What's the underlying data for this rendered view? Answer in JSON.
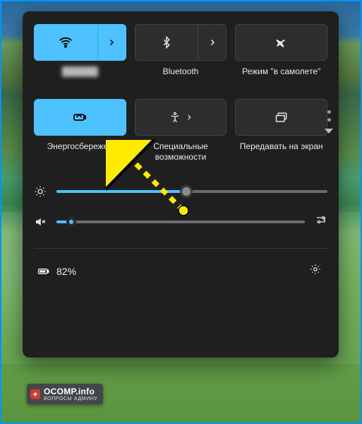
{
  "colors": {
    "accent": "#4dc2ff",
    "panel": "#1f1f1f",
    "tile": "#2d2d2d"
  },
  "tiles": {
    "wifi": {
      "label": "██████",
      "active": true
    },
    "bluetooth": {
      "label": "Bluetooth",
      "active": false
    },
    "airplane": {
      "label": "Режим \"в самолете\"",
      "active": false
    },
    "battery_saver": {
      "label": "Энергосбережен",
      "active": true
    },
    "accessibility": {
      "label": "Специальные возможности",
      "active": false
    },
    "cast": {
      "label": "Передавать на экран",
      "active": false
    }
  },
  "sliders": {
    "brightness": {
      "percent": 48
    },
    "volume": {
      "percent": 6,
      "muted": true
    }
  },
  "battery": {
    "text": "82%"
  },
  "watermark": {
    "main": "OCOMP.info",
    "sub": "ВОПРОСЫ АДМИНУ"
  }
}
